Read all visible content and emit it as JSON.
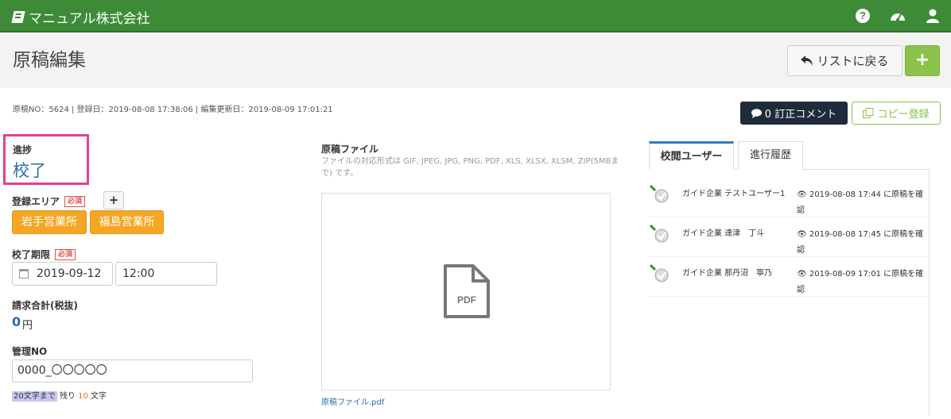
{
  "header": {
    "brand": "マニュアル株式会社"
  },
  "title_bar": {
    "title": "原稿編集",
    "back_label": "リストに戻る",
    "add_label": "+"
  },
  "meta": {
    "text": "原稿NO：5624 |  登録日：2019-08-08 17:38:06 |  編集更新日：2019-08-09 17:01:21"
  },
  "actions": {
    "fix_comment": "0 訂正コメント",
    "copy": "コピー登録"
  },
  "form": {
    "progress_label": "進捗",
    "progress_value": "校了",
    "area_label": "登録エリア",
    "required": "必須",
    "area_add": "+",
    "areas": [
      "岩手営業所",
      "福島営業所"
    ],
    "deadline_label": "校了期限",
    "date_value": "2019-09-12",
    "time_value": "12:00",
    "billing_label": "請求合計(税抜)",
    "billing_value": "0",
    "billing_unit": "円",
    "mgmt_label": "管理NO",
    "mgmt_value": "0000_〇〇〇〇〇",
    "counter_limit": "20文字まで",
    "counter_rest": " 残り ",
    "counter_num": "10",
    "counter_unit": " 文字"
  },
  "file": {
    "label": "原稿ファイル",
    "note": "ファイルの対応形式は GIF, JPEG, JPG, PNG, PDF, XLS, XLSX, XLSM, ZIP(5MBまで) です。",
    "pdf_badge": "PDF",
    "link": "原稿ファイル.pdf"
  },
  "review": {
    "tabs": [
      "校閲ユーザー",
      "進行履歴"
    ],
    "rows": [
      {
        "name": "ガイド企業 テストユーザー1",
        "log": "2019-08-08 17:44 に原稿を確認"
      },
      {
        "name": "ガイド企業 達津　丁斗",
        "log": "2019-08-08 17:45 に原稿を確認"
      },
      {
        "name": "ガイド企業 那丹沼　寧乃",
        "log": "2019-08-09 17:01 に原稿を確認"
      }
    ]
  }
}
